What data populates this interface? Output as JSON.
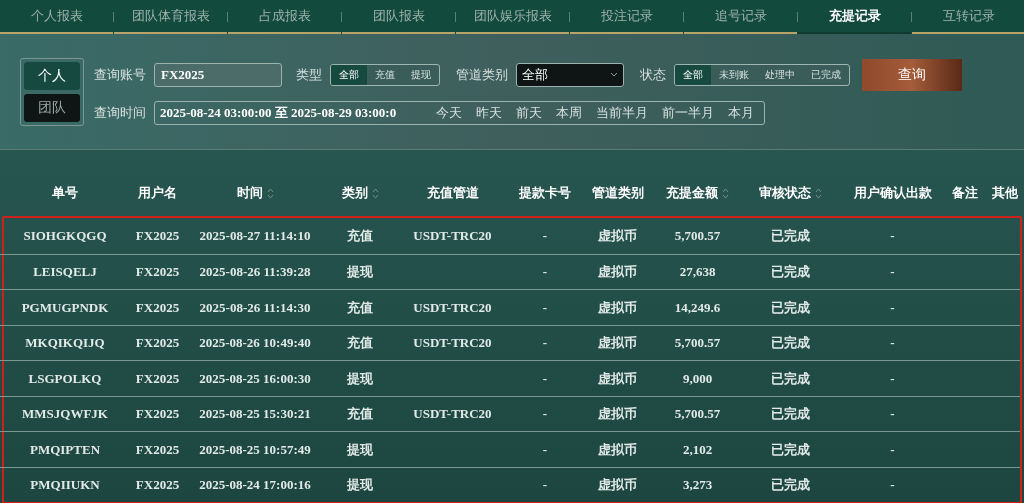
{
  "tabs": [
    {
      "label": "个人报表",
      "selected": false
    },
    {
      "label": "团队体育报表",
      "selected": false
    },
    {
      "label": "占成报表",
      "selected": false
    },
    {
      "label": "团队报表",
      "selected": false
    },
    {
      "label": "团队娱乐报表",
      "selected": false
    },
    {
      "label": "投注记录",
      "selected": false
    },
    {
      "label": "追号记录",
      "selected": false
    },
    {
      "label": "充提记录",
      "selected": true
    },
    {
      "label": "互转记录",
      "selected": false
    }
  ],
  "scope": [
    {
      "label": "个人",
      "selected": true
    },
    {
      "label": "团队",
      "selected": false
    }
  ],
  "filters": {
    "account_label": "查询账号",
    "account_value": "FX2025",
    "type_label": "类型",
    "type_options": [
      {
        "label": "全部",
        "selected": true
      },
      {
        "label": "充值",
        "selected": false
      },
      {
        "label": "提现",
        "selected": false
      }
    ],
    "channel_label": "管道类别",
    "channel_value": "全部",
    "status_label": "状态",
    "status_options": [
      {
        "label": "全部",
        "selected": true
      },
      {
        "label": "未到账",
        "selected": false
      },
      {
        "label": "处理中",
        "selected": false
      },
      {
        "label": "已完成",
        "selected": false
      }
    ],
    "query_button": "查询",
    "time_label": "查询时间",
    "time_value": "2025-08-24 03:00:00 至 2025-08-29 03:00:0",
    "quick_ranges": [
      "今天",
      "昨天",
      "前天",
      "本周",
      "当前半月",
      "前一半月",
      "本月"
    ]
  },
  "table": {
    "columns": [
      {
        "label": "单号",
        "sortable": false
      },
      {
        "label": "用户名",
        "sortable": false
      },
      {
        "label": "时间",
        "sortable": true
      },
      {
        "label": "类别",
        "sortable": true
      },
      {
        "label": "充值管道",
        "sortable": false
      },
      {
        "label": "提款卡号",
        "sortable": false
      },
      {
        "label": "管道类别",
        "sortable": false
      },
      {
        "label": "充提金额",
        "sortable": true
      },
      {
        "label": "审核状态",
        "sortable": true
      },
      {
        "label": "用户确认出款",
        "sortable": false
      },
      {
        "label": "备注",
        "sortable": false
      },
      {
        "label": "其他",
        "sortable": false
      }
    ],
    "rows": [
      [
        "SIOHGKQGQ",
        "FX2025",
        "2025-08-27 11:14:10",
        "充值",
        "USDT-TRC20",
        "-",
        "虚拟币",
        "5,700.57",
        "已完成",
        "-"
      ],
      [
        "LEISQELJ",
        "FX2025",
        "2025-08-26 11:39:28",
        "提现",
        "",
        "-",
        "虚拟币",
        "27,638",
        "已完成",
        "-"
      ],
      [
        "PGMUGPNDK",
        "FX2025",
        "2025-08-26 11:14:30",
        "充值",
        "USDT-TRC20",
        "-",
        "虚拟币",
        "14,249.6",
        "已完成",
        "-"
      ],
      [
        "MKQIKQIJQ",
        "FX2025",
        "2025-08-26 10:49:40",
        "充值",
        "USDT-TRC20",
        "-",
        "虚拟币",
        "5,700.57",
        "已完成",
        "-"
      ],
      [
        "LSGPOLKQ",
        "FX2025",
        "2025-08-25 16:00:30",
        "提现",
        "",
        "-",
        "虚拟币",
        "9,000",
        "已完成",
        "-"
      ],
      [
        "MMSJQWFJK",
        "FX2025",
        "2025-08-25 15:30:21",
        "充值",
        "USDT-TRC20",
        "-",
        "虚拟币",
        "5,700.57",
        "已完成",
        "-"
      ],
      [
        "PMQIPTEN",
        "FX2025",
        "2025-08-25 10:57:49",
        "提现",
        "",
        "-",
        "虚拟币",
        "2,102",
        "已完成",
        "-"
      ],
      [
        "PMQIIUKN",
        "FX2025",
        "2025-08-24 17:00:16",
        "提现",
        "",
        "-",
        "虚拟币",
        "3,273",
        "已完成",
        "-"
      ]
    ]
  }
}
